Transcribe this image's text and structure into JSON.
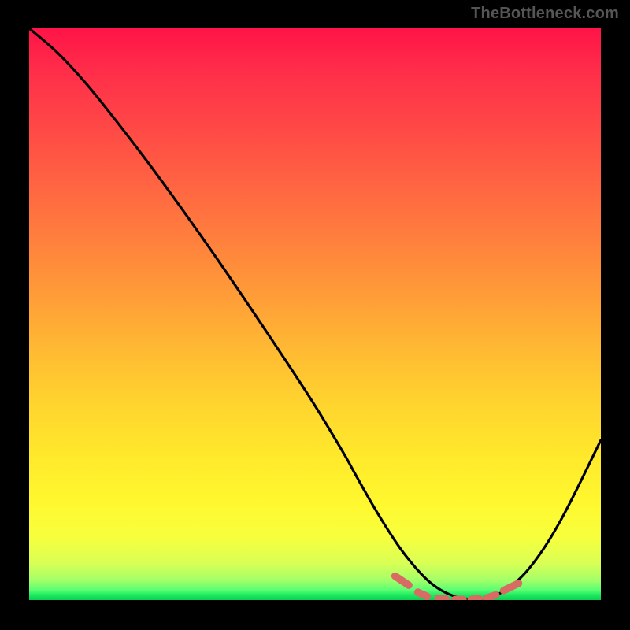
{
  "attribution": "TheBottleneck.com",
  "chart_data": {
    "type": "line",
    "title": "",
    "xlabel": "",
    "ylabel": "",
    "xlim": [
      0,
      100
    ],
    "ylim": [
      0,
      100
    ],
    "series": [
      {
        "name": "bottleneck-curve",
        "x": [
          0,
          5,
          10,
          15,
          20,
          25,
          30,
          35,
          40,
          45,
          50,
          55,
          57,
          60,
          63,
          66,
          70,
          74,
          78,
          81,
          84,
          87,
          90,
          93,
          96,
          100
        ],
        "y": [
          100,
          95.7,
          90.3,
          84.1,
          77.6,
          70.8,
          63.8,
          56.6,
          49.2,
          41.7,
          34.0,
          25.7,
          22.1,
          16.8,
          11.9,
          7.6,
          3.2,
          0.8,
          0.1,
          0.6,
          2.2,
          5.0,
          9.0,
          14.0,
          19.8,
          28.0
        ]
      }
    ],
    "optimal_zone_dashes": [
      {
        "x": 65.2,
        "y": 3.4
      },
      {
        "x": 68.8,
        "y": 1.0
      },
      {
        "x": 72.2,
        "y": 0.25
      },
      {
        "x": 75.2,
        "y": 0.1
      },
      {
        "x": 78.0,
        "y": 0.15
      },
      {
        "x": 80.8,
        "y": 0.6
      },
      {
        "x": 84.3,
        "y": 2.3
      }
    ],
    "colors": {
      "curve": "#000000",
      "dash": "#d86b63",
      "gradient_top": "#ff1447",
      "gradient_bottom": "#0ed052"
    }
  }
}
